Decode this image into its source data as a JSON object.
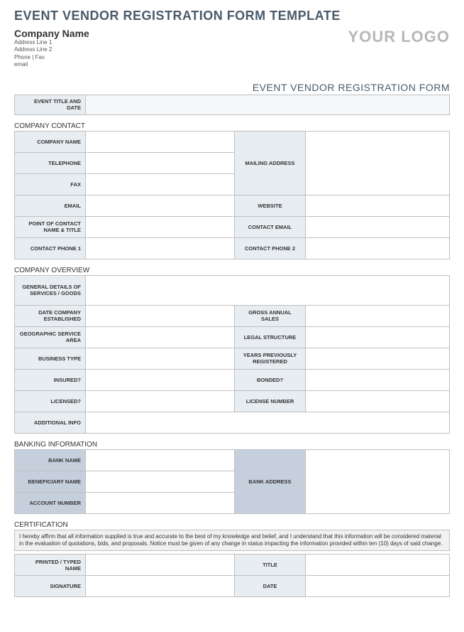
{
  "page_title": "EVENT VENDOR REGISTRATION FORM TEMPLATE",
  "company": {
    "name": "Company Name",
    "address1": "Address Line 1",
    "address2": "Address Line 2",
    "phonefax": "Phone | Fax",
    "email": "email"
  },
  "logo": "YOUR LOGO",
  "form_title": "EVENT VENDOR REGISTRATION FORM",
  "event": {
    "label": "EVENT TITLE AND DATE",
    "value": ""
  },
  "sections": {
    "contact": {
      "title": "COMPANY CONTACT",
      "labels": {
        "company_name": "COMPANY NAME",
        "telephone": "TELEPHONE",
        "fax": "FAX",
        "mailing_address": "MAILING ADDRESS",
        "email": "EMAIL",
        "website": "WEBSITE",
        "poc": "POINT OF CONTACT NAME & TITLE",
        "contact_email": "CONTACT EMAIL",
        "contact_phone1": "CONTACT PHONE 1",
        "contact_phone2": "CONTACT PHONE 2"
      }
    },
    "overview": {
      "title": "COMPANY OVERVIEW",
      "labels": {
        "details": "GENERAL DETAILS OF SERVICES / GOODS",
        "established": "DATE COMPANY ESTABLISHED",
        "gross_sales": "GROSS ANNUAL SALES",
        "geo": "GEOGRAPHIC SERVICE AREA",
        "legal": "LEGAL STRUCTURE",
        "btype": "BUSINESS TYPE",
        "years": "YEARS PREVIOUSLY REGISTERED",
        "insured": "INSURED?",
        "bonded": "BONDED?",
        "licensed": "LICENSED?",
        "license_no": "LICENSE NUMBER",
        "additional": "ADDITIONAL INFO"
      }
    },
    "banking": {
      "title": "BANKING INFORMATION",
      "labels": {
        "bank_name": "BANK NAME",
        "beneficiary": "BENEFICIARY NAME",
        "account": "ACCOUNT NUMBER",
        "bank_address": "BANK ADDRESS"
      }
    },
    "cert": {
      "title": "CERTIFICATION",
      "text": "I hereby affirm that all information supplied is true and accurate to the best of my knowledge and belief, and I understand that this information will be considered material in the evaluation of quotations, bids, and proposals. Notice must be given of any change in status impacting the information provided within ten (10) days of said change.",
      "labels": {
        "printed": "PRINTED / TYPED NAME",
        "title": "TITLE",
        "signature": "SIGNATURE",
        "date": "DATE"
      }
    }
  }
}
